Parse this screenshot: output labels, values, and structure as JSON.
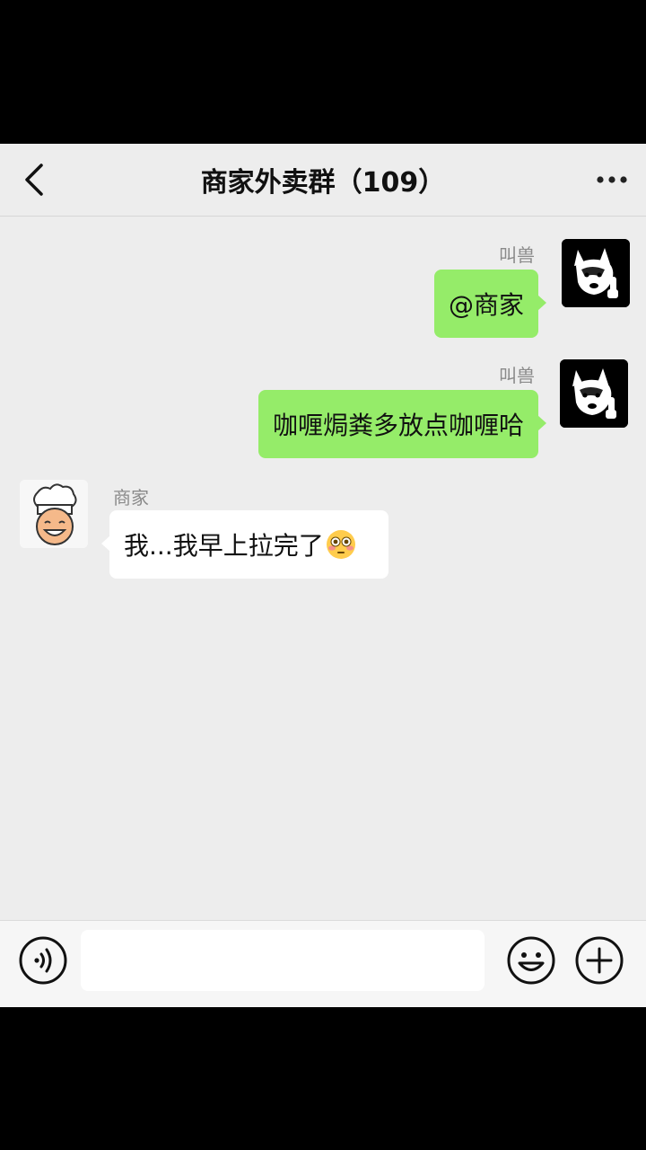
{
  "header": {
    "title": "商家外卖群（109）"
  },
  "icons": {
    "back": "chevron-left-icon",
    "more": "more-dots-icon",
    "voice": "voice-icon",
    "emoji": "emoji-smile-icon",
    "plus": "plus-circle-icon",
    "flushed": "flushed-face-emoji"
  },
  "messages": [
    {
      "sender": "叫兽",
      "text": "@商家",
      "side": "right"
    },
    {
      "sender": "叫兽",
      "text": "咖喱焗粪多放点咖喱哈",
      "side": "right"
    },
    {
      "sender": "商家",
      "text": "我...我早上拉完了",
      "side": "left"
    }
  ],
  "input": {
    "value": "",
    "placeholder": ""
  },
  "colors": {
    "sent_bubble": "#95ec69",
    "received_bubble": "#ffffff",
    "chat_background": "#ededed"
  }
}
